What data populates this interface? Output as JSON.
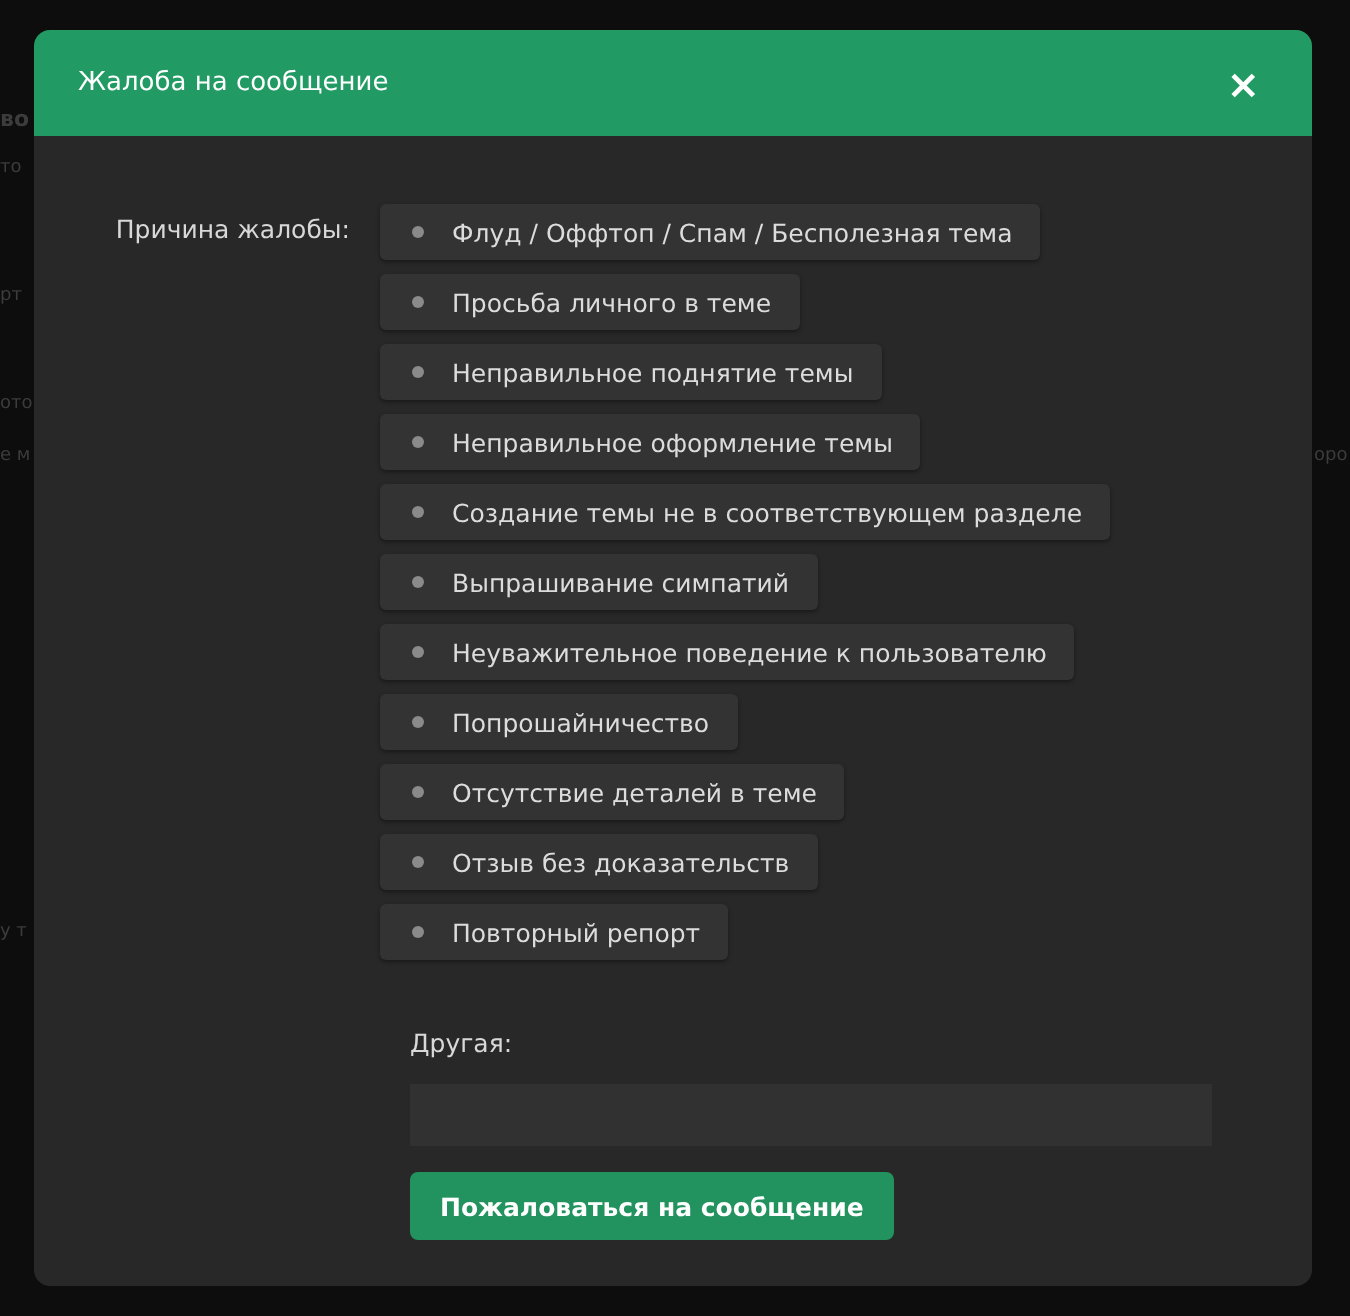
{
  "background_fragments": {
    "left": [
      {
        "text": "во",
        "kind": "heading"
      },
      {
        "text": "то",
        "kind": "text"
      },
      {
        "text": "рт",
        "kind": "text"
      },
      {
        "text": "ото",
        "kind": "text"
      },
      {
        "text": "е м",
        "kind": "text"
      },
      {
        "text": "у т",
        "kind": "text"
      }
    ],
    "right": [
      {
        "text": "оро"
      }
    ]
  },
  "dialog": {
    "title": "Жалоба на сообщение",
    "close": "×",
    "reason_label": "Причина жалобы:",
    "reasons": [
      "Флуд / Оффтоп / Спам / Бесполезная тема",
      "Просьба личного в теме",
      "Неправильное поднятие темы",
      "Неправильное оформление темы",
      "Создание темы не в соответствующем разделе",
      "Выпрашивание симпатий",
      "Неуважительное поведение к пользователю",
      "Попрошайничество",
      "Отсутствие деталей в теме",
      "Отзыв без доказательств",
      "Повторный репорт"
    ],
    "other_label": "Другая:",
    "submit": "Пожаловаться на сообщение"
  }
}
